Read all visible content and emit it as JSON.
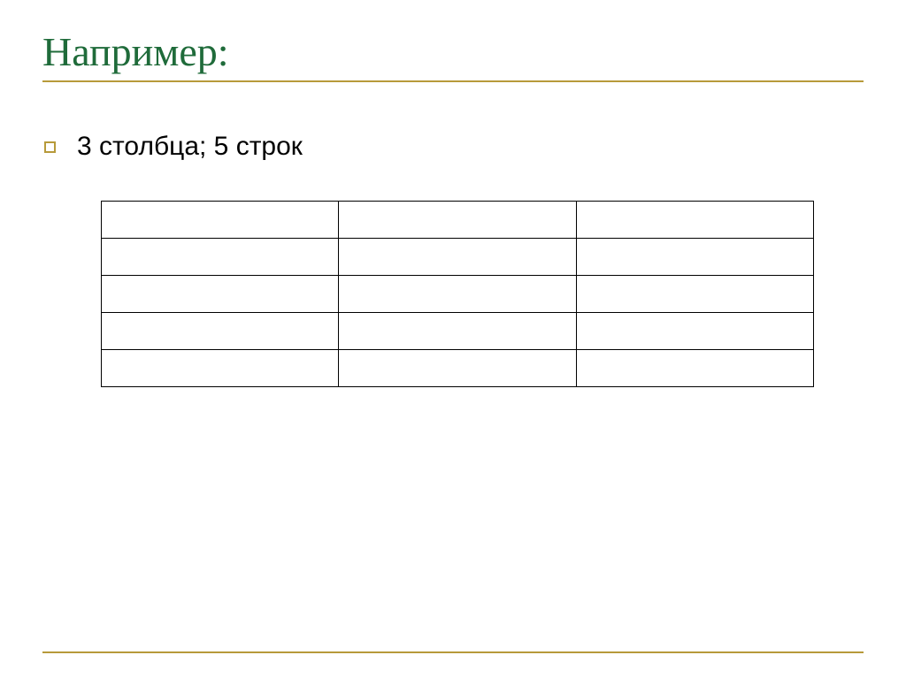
{
  "title": "Например:",
  "bullet": {
    "text": "3 столбца; 5 строк"
  },
  "table": {
    "columns": 3,
    "rows": 5
  },
  "colors": {
    "title": "#1f6b3a",
    "accent": "#b79a3a"
  }
}
